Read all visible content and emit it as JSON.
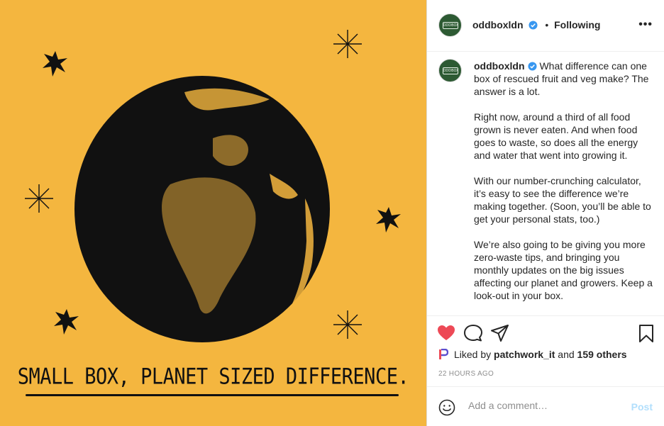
{
  "image": {
    "tagline": "SMALL BOX, PLANET SIZED DIFFERENCE.",
    "background_color": "#F4B63F"
  },
  "header": {
    "username": "oddboxldn",
    "separator": "•",
    "follow_status": "Following",
    "more_label": "•••",
    "avatar_logo_text": "ODDBOX"
  },
  "caption": {
    "username": "oddboxldn",
    "first_line": "What difference can one box of rescued fruit and veg make? The answer is a lot.",
    "paragraphs": [
      "Right now, around a third of all food grown is never eaten. And when food goes to waste, so does all the energy and water that went into growing it.",
      "With our number-crunching calculator, it’s easy to see the difference we’re making together. (Soon, you’ll be able to get your personal stats, too.)",
      "We’re also going to be giving you more zero-waste tips, and bringing you monthly updates on the big issues affecting our planet and growers. Keep a look-out in your box."
    ]
  },
  "actions": {
    "liked_prefix": "Liked by",
    "liked_user": "patchwork_it",
    "liked_and": "and",
    "liked_others": "159 others",
    "timestamp": "22 HOURS AGO",
    "like_color": "#ED4956"
  },
  "comment_box": {
    "placeholder": "Add a comment…",
    "post_label": "Post"
  }
}
